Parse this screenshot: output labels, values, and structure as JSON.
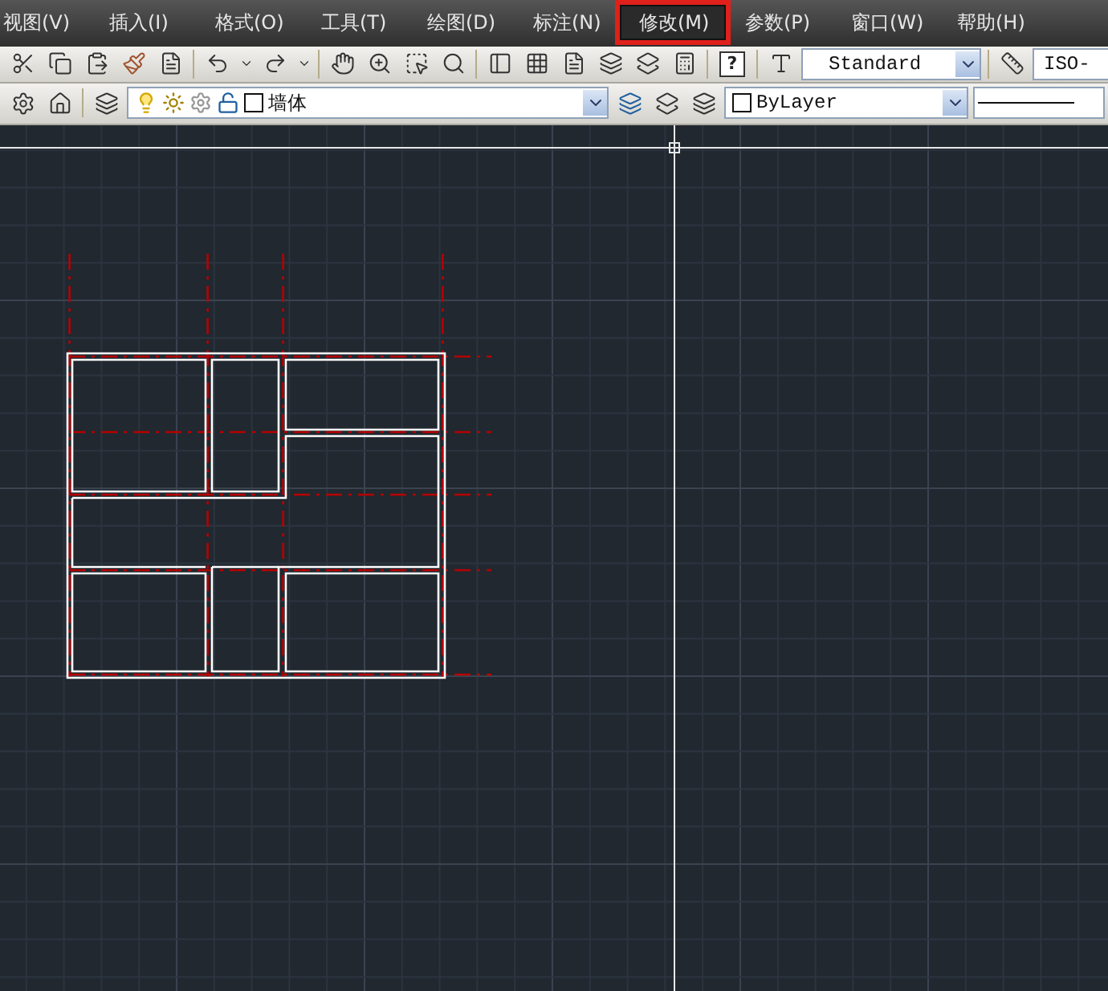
{
  "menu": [
    {
      "label": "视图(V)",
      "selected": false
    },
    {
      "label": "插入(I)",
      "selected": false
    },
    {
      "label": "格式(O)",
      "selected": false
    },
    {
      "label": "工具(T)",
      "selected": false
    },
    {
      "label": "绘图(D)",
      "selected": false
    },
    {
      "label": "标注(N)",
      "selected": false
    },
    {
      "label": "修改(M)",
      "selected": true
    },
    {
      "label": "参数(P)",
      "selected": false
    },
    {
      "label": "窗口(W)",
      "selected": false
    },
    {
      "label": "帮助(H)",
      "selected": false
    }
  ],
  "toolbar": {
    "help_key": "?",
    "text_style": "Standard",
    "dim_style": "ISO-"
  },
  "layer_bar": {
    "layer": "墙体",
    "color_name": "ByLayer"
  }
}
